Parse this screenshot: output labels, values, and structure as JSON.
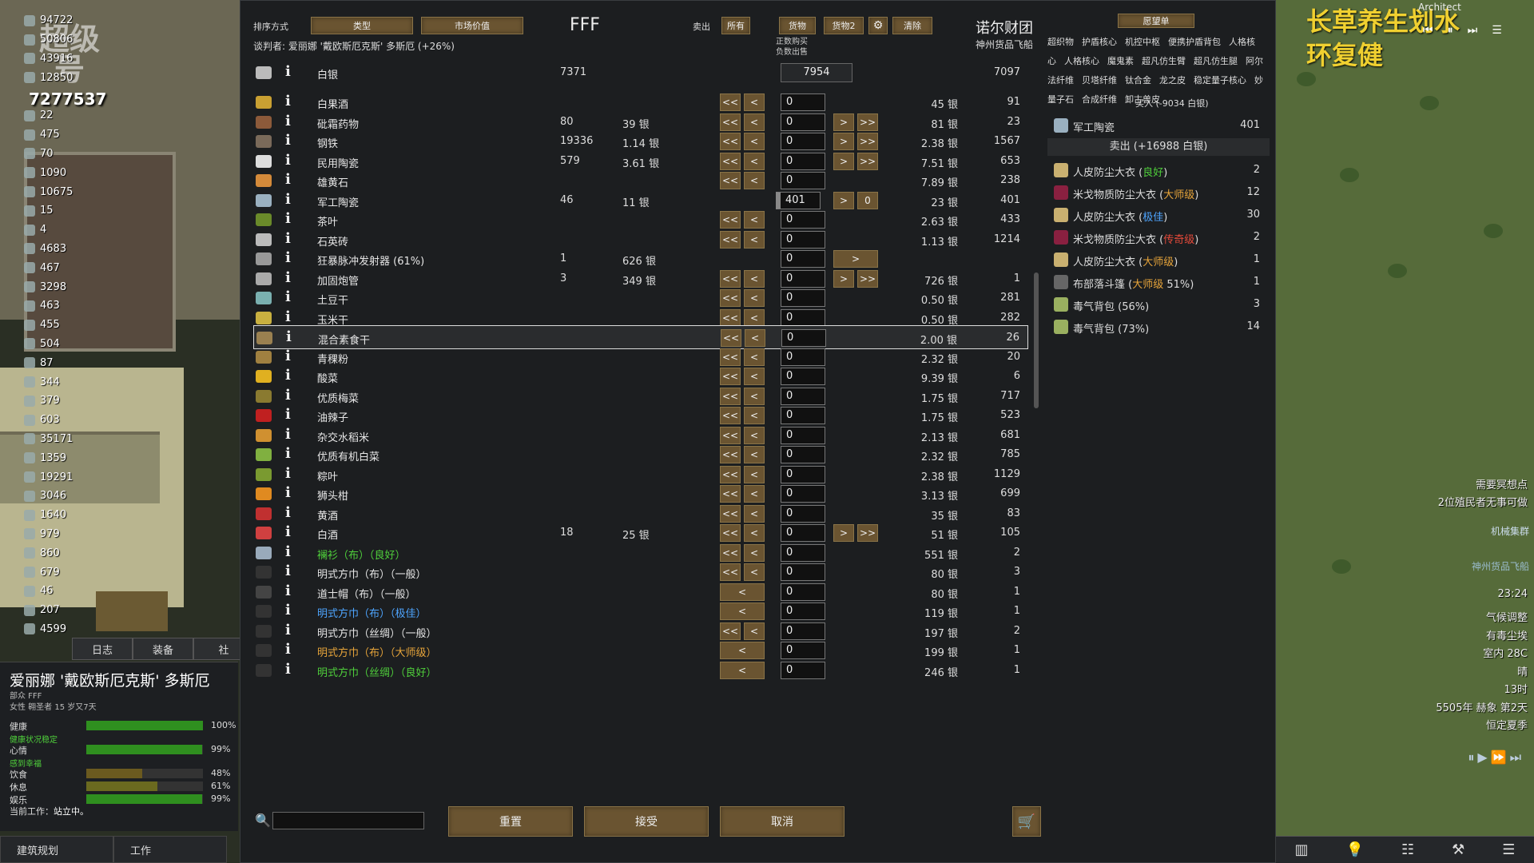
{
  "colony": {
    "logo_text": "超级号",
    "resources": [
      "94722",
      "50806",
      "43916",
      "12850",
      "7277537",
      "22",
      "475",
      "70",
      "1090",
      "10675",
      "15",
      "4",
      "4683",
      "467",
      "3298",
      "463",
      "455",
      "504",
      "87",
      "344",
      "379",
      "603",
      "35171",
      "1359",
      "19291",
      "3046",
      "1640",
      "979",
      "860",
      "679",
      "46",
      "207",
      "4599"
    ],
    "silver_big": "7277537"
  },
  "colonist": {
    "tabs": [
      "日志",
      "装备",
      "社"
    ],
    "name": "爱丽娜 '戴欧斯厄克斯' 多斯厄",
    "faction": "部众 FFF",
    "desc": "女性 翱圣者 15 岁又7天",
    "needs": [
      {
        "label": "健康",
        "pct": "100%",
        "value": 1.0,
        "color": "#2f8f1f"
      },
      {
        "label": "心情",
        "pct": "99%",
        "value": 0.99,
        "color": "#2f8f1f"
      },
      {
        "label": "饮食",
        "pct": "48%",
        "value": 0.48,
        "color": "#6b5a1f"
      },
      {
        "label": "休息",
        "pct": "61%",
        "value": 0.61,
        "color": "#6b6a1f"
      },
      {
        "label": "娱乐",
        "pct": "99%",
        "value": 0.99,
        "color": "#2f8f1f"
      }
    ],
    "note_health": "健康状况稳定",
    "note_mood": "感到幸福",
    "current_job_label": "当前工作：",
    "current_job": "站立中。",
    "bottom_buttons": [
      "建筑规划",
      "工作"
    ]
  },
  "trade": {
    "sort_label": "排序方式",
    "sort_by": "类型",
    "sort_by2": "市场价值",
    "title": "FFF",
    "sell_label": "卖出",
    "filter_buttons": [
      "所有",
      "货物",
      "货物2"
    ],
    "clear_button": "清除",
    "faction_name": "诺尔财团",
    "faction_ship": "神州货品飞船",
    "negotiator": "谈判者: 爱丽娜 '戴欧斯厄克斯' 多斯厄 (+26%)",
    "trade_note": "正数购买\n负数出售",
    "silver_row": {
      "name": "白银",
      "count": "7371",
      "value": "7954",
      "tcount": "7097"
    },
    "rows": [
      {
        "name": "白果酒",
        "count": "",
        "cprice": "",
        "buy": true,
        "sell": false,
        "qty": "0",
        "tprice": "45 银",
        "tcount": "91",
        "icon": "#c9a032"
      },
      {
        "name": "砒霜药物",
        "count": "80",
        "cprice": "39 银",
        "buy": true,
        "sell": true,
        "qty": "0",
        "tprice": "81 银",
        "tcount": "23",
        "icon": "#8c5a3a"
      },
      {
        "name": "钢铁",
        "count": "19336",
        "cprice": "1.14 银",
        "buy": true,
        "sell": true,
        "qty": "0",
        "tprice": "2.38 银",
        "tcount": "1567",
        "icon": "#7a6a5a"
      },
      {
        "name": "民用陶瓷",
        "count": "579",
        "cprice": "3.61 银",
        "buy": true,
        "sell": true,
        "qty": "0",
        "tprice": "7.51 银",
        "tcount": "653",
        "icon": "#ddd"
      },
      {
        "name": "雄黄石",
        "count": "",
        "cprice": "",
        "buy": true,
        "sell": false,
        "qty": "0",
        "tprice": "7.89 银",
        "tcount": "238",
        "icon": "#d48a3a"
      },
      {
        "name": "军工陶瓷",
        "count": "46",
        "cprice": "11 银",
        "buy": false,
        "sell": true,
        "qty": "401",
        "tprice": "23 银",
        "tcount": "401",
        "icon": "#9ab0c0",
        "special": true
      },
      {
        "name": "茶叶",
        "count": "",
        "cprice": "",
        "buy": true,
        "sell": false,
        "qty": "0",
        "tprice": "2.63 银",
        "tcount": "433",
        "icon": "#6a8a2a"
      },
      {
        "name": "石英砖",
        "count": "",
        "cprice": "",
        "buy": true,
        "sell": false,
        "qty": "0",
        "tprice": "1.13 银",
        "tcount": "1214",
        "icon": "#bbb"
      },
      {
        "name": "狂暴脉冲发射器 (61%)",
        "count": "1",
        "cprice": "626 银",
        "buy": false,
        "sell": true,
        "single": true,
        "qty": "0",
        "tprice": "",
        "tcount": "",
        "icon": "#999"
      },
      {
        "name": "加固炮管",
        "count": "3",
        "cprice": "349 银",
        "buy": true,
        "sell": true,
        "qty": "0",
        "tprice": "726 银",
        "tcount": "1",
        "icon": "#aaa"
      },
      {
        "name": "土豆干",
        "count": "",
        "cprice": "",
        "buy": true,
        "sell": false,
        "qty": "0",
        "tprice": "0.50 银",
        "tcount": "281",
        "icon": "#7ab0b0"
      },
      {
        "name": "玉米干",
        "count": "",
        "cprice": "",
        "buy": true,
        "sell": false,
        "qty": "0",
        "tprice": "0.50 银",
        "tcount": "282",
        "icon": "#c9b040"
      },
      {
        "name": "混合素食干",
        "count": "",
        "cprice": "",
        "buy": true,
        "sell": false,
        "qty": "0",
        "tprice": "2.00 银",
        "tcount": "26",
        "icon": "#9a8050",
        "hl": true
      },
      {
        "name": "青稞粉",
        "count": "",
        "cprice": "",
        "buy": true,
        "sell": false,
        "qty": "0",
        "tprice": "2.32 银",
        "tcount": "20",
        "icon": "#a08040"
      },
      {
        "name": "酸菜",
        "count": "",
        "cprice": "",
        "buy": true,
        "sell": false,
        "qty": "0",
        "tprice": "9.39 银",
        "tcount": "6",
        "icon": "#e0b020"
      },
      {
        "name": "优质梅菜",
        "count": "",
        "cprice": "",
        "buy": true,
        "sell": false,
        "qty": "0",
        "tprice": "1.75 银",
        "tcount": "717",
        "icon": "#8a7a30"
      },
      {
        "name": "油辣子",
        "count": "",
        "cprice": "",
        "buy": true,
        "sell": false,
        "qty": "0",
        "tprice": "1.75 银",
        "tcount": "523",
        "icon": "#c02020"
      },
      {
        "name": "杂交水稻米",
        "count": "",
        "cprice": "",
        "buy": true,
        "sell": false,
        "qty": "0",
        "tprice": "2.13 银",
        "tcount": "681",
        "icon": "#d09030"
      },
      {
        "name": "优质有机白菜",
        "count": "",
        "cprice": "",
        "buy": true,
        "sell": false,
        "qty": "0",
        "tprice": "2.32 银",
        "tcount": "785",
        "icon": "#80b040"
      },
      {
        "name": "粽叶",
        "count": "",
        "cprice": "",
        "buy": true,
        "sell": false,
        "qty": "0",
        "tprice": "2.38 银",
        "tcount": "1129",
        "icon": "#7a9a30"
      },
      {
        "name": "狮头柑",
        "count": "",
        "cprice": "",
        "buy": true,
        "sell": false,
        "qty": "0",
        "tprice": "3.13 银",
        "tcount": "699",
        "icon": "#e08a20"
      },
      {
        "name": "黄酒",
        "count": "",
        "cprice": "",
        "buy": true,
        "sell": false,
        "qty": "0",
        "tprice": "35 银",
        "tcount": "83",
        "icon": "#c03030"
      },
      {
        "name": "白酒",
        "count": "18",
        "cprice": "25 银",
        "buy": true,
        "sell": true,
        "qty": "0",
        "tprice": "51 银",
        "tcount": "105",
        "icon": "#d04040"
      },
      {
        "name": "襕衫（布）（良好）",
        "count": "",
        "cprice": "",
        "buy": true,
        "sell": false,
        "qty": "0",
        "tprice": "551 银",
        "tcount": "2",
        "icon": "#9ab",
        "q": "good"
      },
      {
        "name": "明式方巾（布）（一般）",
        "count": "",
        "cprice": "",
        "buy": true,
        "sell": false,
        "qty": "0",
        "tprice": "80 银",
        "tcount": "3",
        "icon": "#333"
      },
      {
        "name": "道士帽（布）（一般）",
        "count": "",
        "cprice": "",
        "buy": false,
        "single_buy": true,
        "sell": false,
        "qty": "0",
        "tprice": "80 银",
        "tcount": "1",
        "icon": "#444"
      },
      {
        "name": "明式方巾（布）（极佳）",
        "count": "",
        "cprice": "",
        "buy": false,
        "single_buy": true,
        "sell": false,
        "qty": "0",
        "tprice": "119 银",
        "tcount": "1",
        "icon": "#333",
        "q": "exc"
      },
      {
        "name": "明式方巾（丝绸）（一般）",
        "count": "",
        "cprice": "",
        "buy": true,
        "sell": false,
        "qty": "0",
        "tprice": "197 银",
        "tcount": "2",
        "icon": "#333"
      },
      {
        "name": "明式方巾（布）（大师级）",
        "count": "",
        "cprice": "",
        "buy": false,
        "single_buy": true,
        "sell": false,
        "qty": "0",
        "tprice": "199 银",
        "tcount": "1",
        "icon": "#333",
        "q": "master"
      },
      {
        "name": "明式方巾（丝绸）（良好）",
        "count": "",
        "cprice": "",
        "buy": false,
        "single_buy": true,
        "sell": false,
        "qty": "0",
        "tprice": "246 银",
        "tcount": "1",
        "icon": "#333",
        "q": "good"
      }
    ],
    "footer": {
      "reset": "重置",
      "accept": "接受",
      "cancel": "取消"
    }
  },
  "wishlist": {
    "title": "愿望单",
    "tags": [
      "超织物",
      "护盾核心",
      "机控中枢",
      "便携护盾背包",
      "人格核心",
      "人格核心",
      "魔鬼素",
      "超凡仿生臂",
      "超凡仿生腿",
      "阿尔法纤维",
      "贝塔纤维",
      "钛合金",
      "龙之皮",
      "稳定量子核心",
      "妙量子石",
      "合成纤维",
      "卸古兽皮"
    ],
    "buy_header": "买入 (-9034 白银)",
    "buy_items": [
      {
        "name": "军工陶瓷",
        "count": "401",
        "icon": "#9ab0c0"
      }
    ],
    "sell_header": "卖出 (+16988 白银)",
    "sell_items": [
      {
        "name": "人皮防尘大衣",
        "q": "良好",
        "qc": "good",
        "count": "2",
        "icon": "#c9b070"
      },
      {
        "name": "米戈物质防尘大衣",
        "q": "大师级",
        "qc": "master",
        "count": "12",
        "icon": "#8a2040"
      },
      {
        "name": "人皮防尘大衣",
        "q": "极佳",
        "qc": "exc",
        "count": "30",
        "icon": "#c9b070"
      },
      {
        "name": "米戈物质防尘大衣",
        "q": "传奇级",
        "qc": "legend",
        "count": "2",
        "icon": "#8a2040"
      },
      {
        "name": "人皮防尘大衣",
        "q": "大师级",
        "qc": "master",
        "count": "1",
        "icon": "#c9b070"
      },
      {
        "name": "布部落斗篷",
        "q": "大师级",
        "qc": "master",
        "extra": " 51%)",
        "count": "1",
        "icon": "#666"
      },
      {
        "name": "毒气背包 (56%)",
        "q": "",
        "qc": "",
        "count": "3",
        "icon": "#9ab060"
      },
      {
        "name": "毒气背包 (73%)",
        "q": "",
        "qc": "",
        "count": "14",
        "icon": "#9ab060"
      }
    ]
  },
  "hud": {
    "overlay_title": "长草养生划水\n环复健",
    "architect": "Architect",
    "alerts": [
      "需要冥想点",
      "2位殖民者无事可做",
      "机械集群",
      "神州货品飞船"
    ],
    "time": "23:24",
    "weather": [
      "气候调整",
      "有毒尘埃",
      "室内 28C",
      "晴",
      "13时",
      "5505年 赫象 第2天",
      "恒定夏季"
    ]
  }
}
